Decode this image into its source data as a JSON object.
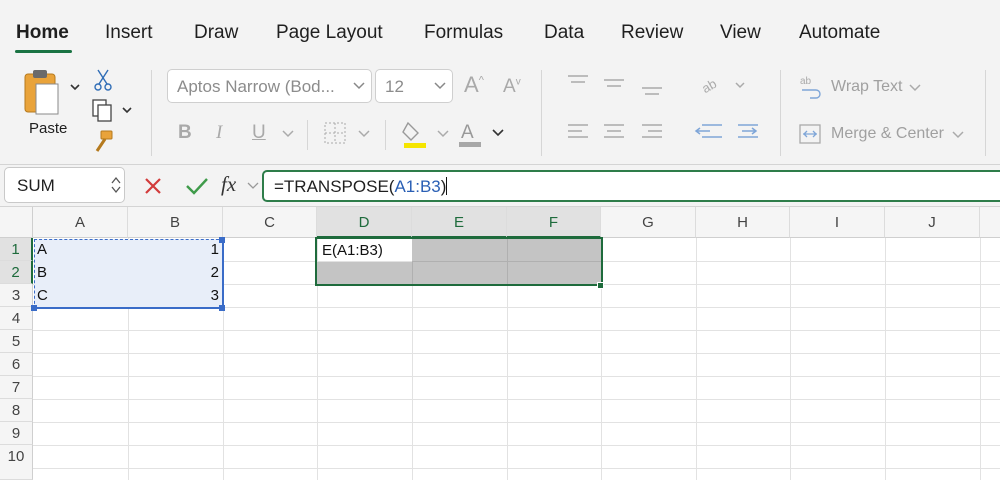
{
  "ribbon": {
    "tabs": [
      {
        "label": "Home",
        "active": true
      },
      {
        "label": "Insert"
      },
      {
        "label": "Draw"
      },
      {
        "label": "Page Layout"
      },
      {
        "label": "Formulas"
      },
      {
        "label": "Data"
      },
      {
        "label": "Review"
      },
      {
        "label": "View"
      },
      {
        "label": "Automate"
      }
    ],
    "paste_label": "Paste",
    "font_name": "Aptos Narrow (Bod...",
    "font_size": "12",
    "wrap_text_label": "Wrap Text",
    "merge_center_label": "Merge & Center",
    "accent_color": "#1a7343"
  },
  "formula_bar": {
    "name_box": "SUM",
    "fx_label": "fx",
    "formula_prefix": "=TRANSPOSE(",
    "formula_ref": "A1:B3",
    "formula_suffix": ")"
  },
  "grid": {
    "columns": [
      "A",
      "B",
      "C",
      "D",
      "E",
      "F",
      "G",
      "H",
      "I",
      "J"
    ],
    "rows": [
      "1",
      "2",
      "3",
      "4",
      "5",
      "6",
      "7",
      "8",
      "9",
      "10"
    ],
    "cells": {
      "A1": "A",
      "B1": "1",
      "A2": "B",
      "B2": "2",
      "A3": "C",
      "B3": "3",
      "D1": "E(A1:B3)"
    }
  }
}
